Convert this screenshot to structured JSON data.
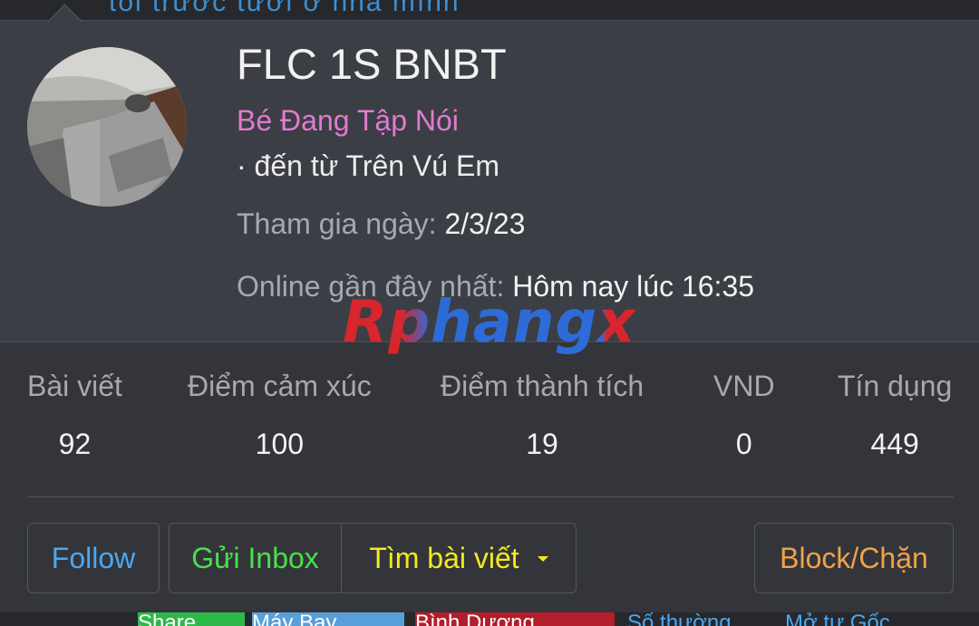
{
  "background": {
    "top_text": "tổi trước tươi ở nhà mình",
    "bottom_chips": [
      {
        "text": "Share",
        "bg": "#2fb84a"
      },
      {
        "text": "Máy Bay",
        "bg": "#5aa0d8"
      },
      {
        "text": "Bình Dương",
        "bg": "#b21e2b"
      },
      {
        "text": "Số thường",
        "bg": "transparent"
      },
      {
        "text": "Mở tư Gốc",
        "bg": "transparent"
      }
    ]
  },
  "profile": {
    "name": "FLC 1S BNBT",
    "user_title": "Bé Đang Tập Nói",
    "location_prefix": "· đến từ ",
    "location": "Trên Vú Em",
    "joined_label": "Tham gia ngày: ",
    "joined_value": "2/3/23",
    "online_label": "Online gần đây nhất: ",
    "online_value": "Hôm nay lúc 16:35"
  },
  "watermark": "Rphangx",
  "stats": [
    {
      "label": "Bài viết",
      "value": "92"
    },
    {
      "label": "Điểm cảm xúc",
      "value": "100"
    },
    {
      "label": "Điểm thành tích",
      "value": "19"
    },
    {
      "label": "VND",
      "value": "0"
    },
    {
      "label": "Tín dụng",
      "value": "449"
    }
  ],
  "actions": {
    "follow": "Follow",
    "inbox": "Gửi Inbox",
    "search_posts": "Tìm bài viết",
    "block": "Block/Chặn"
  },
  "colors": {
    "card_bg": "#3c3e45",
    "stats_bg": "#33353b",
    "user_title": "#e07bd0",
    "follow": "#4aa8f0",
    "inbox": "#4be04b",
    "search": "#f5ea1f",
    "block": "#f0a24a"
  }
}
